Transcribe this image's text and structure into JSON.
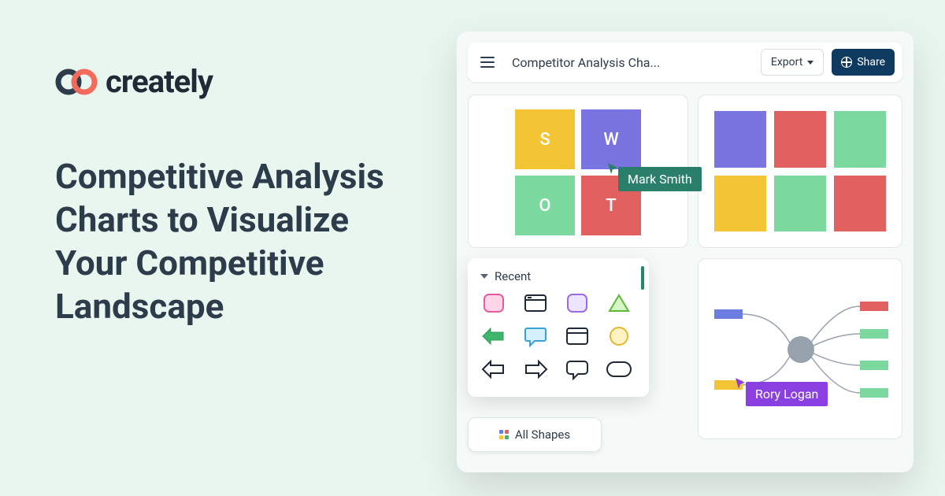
{
  "brand": {
    "name": "creately"
  },
  "headline": "Competitive Analysis Charts to Visualize Your Competitive Landscape",
  "toolbar": {
    "doc_title": "Competitor Analysis Cha...",
    "export_label": "Export",
    "share_label": "Share"
  },
  "swot": {
    "s": "S",
    "w": "W",
    "o": "O",
    "t": "T"
  },
  "shapes_panel": {
    "section_label": "Recent",
    "all_shapes_label": "All Shapes"
  },
  "collaborators": {
    "user1": "Mark Smith",
    "user2": "Rory Logan"
  },
  "colors": {
    "yellow": "#f3c535",
    "purple": "#7a74e0",
    "green": "#7bd89f",
    "red": "#e36060",
    "blue": "#5a7ee0"
  }
}
